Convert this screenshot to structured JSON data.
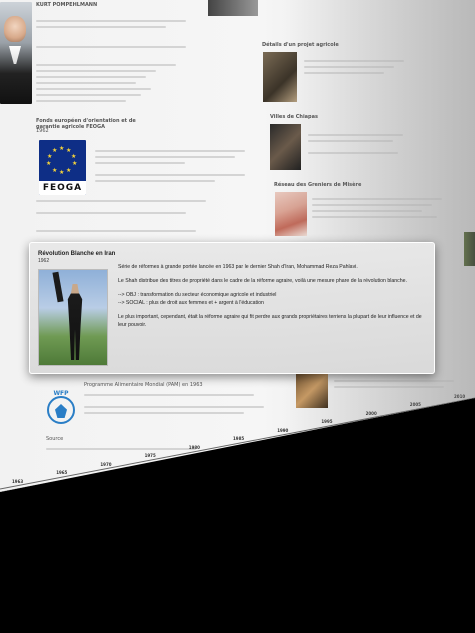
{
  "page": {
    "top_heading": "KURT POMPEHLMANN",
    "col2_title": "Détails d'un projet agricole",
    "col3_title": "Villes de Chiapas",
    "col4_title": "Réseau des Greniers de Misère",
    "feoga_heading": "Fonds européen d'orientation et de garantie agricole FEOGA",
    "feoga_year": "1962",
    "feoga_logo_text": "FEOGA",
    "wfp_logo_text": "WFP",
    "wfp_heading": "Programme Alimentaire Mondial (PAM) en 1963",
    "small_label": "Source"
  },
  "popup": {
    "title": "Révolution Blanche en Iran",
    "year": "1962",
    "paragraph1": "Série de réformes à grande portée lancée en 1963 par le dernier Shah d'Iran, Mohammad Reza Pahlavi.",
    "paragraph2": "Le Shah distribue des titres de propriété dans le cadre de la réforme agraire, voilà une mesure phare de la révolution blanche.",
    "bullet1": "--> OBJ : transformation du secteur économique agricole et industriel",
    "bullet2": "--> SOCIAL : plus de droit aux femmes et + argent à l'éducation",
    "paragraph3": "Le plus important, cependant, était la réforme agraire qui fit perdre aux grands propriétaires terriens la plupart de leur influence et de leur pouvoir."
  },
  "timeline": {
    "years": [
      "1963",
      "1965",
      "1970",
      "1975",
      "1980",
      "1985",
      "1990",
      "1995",
      "2000",
      "2005",
      "2010"
    ]
  }
}
